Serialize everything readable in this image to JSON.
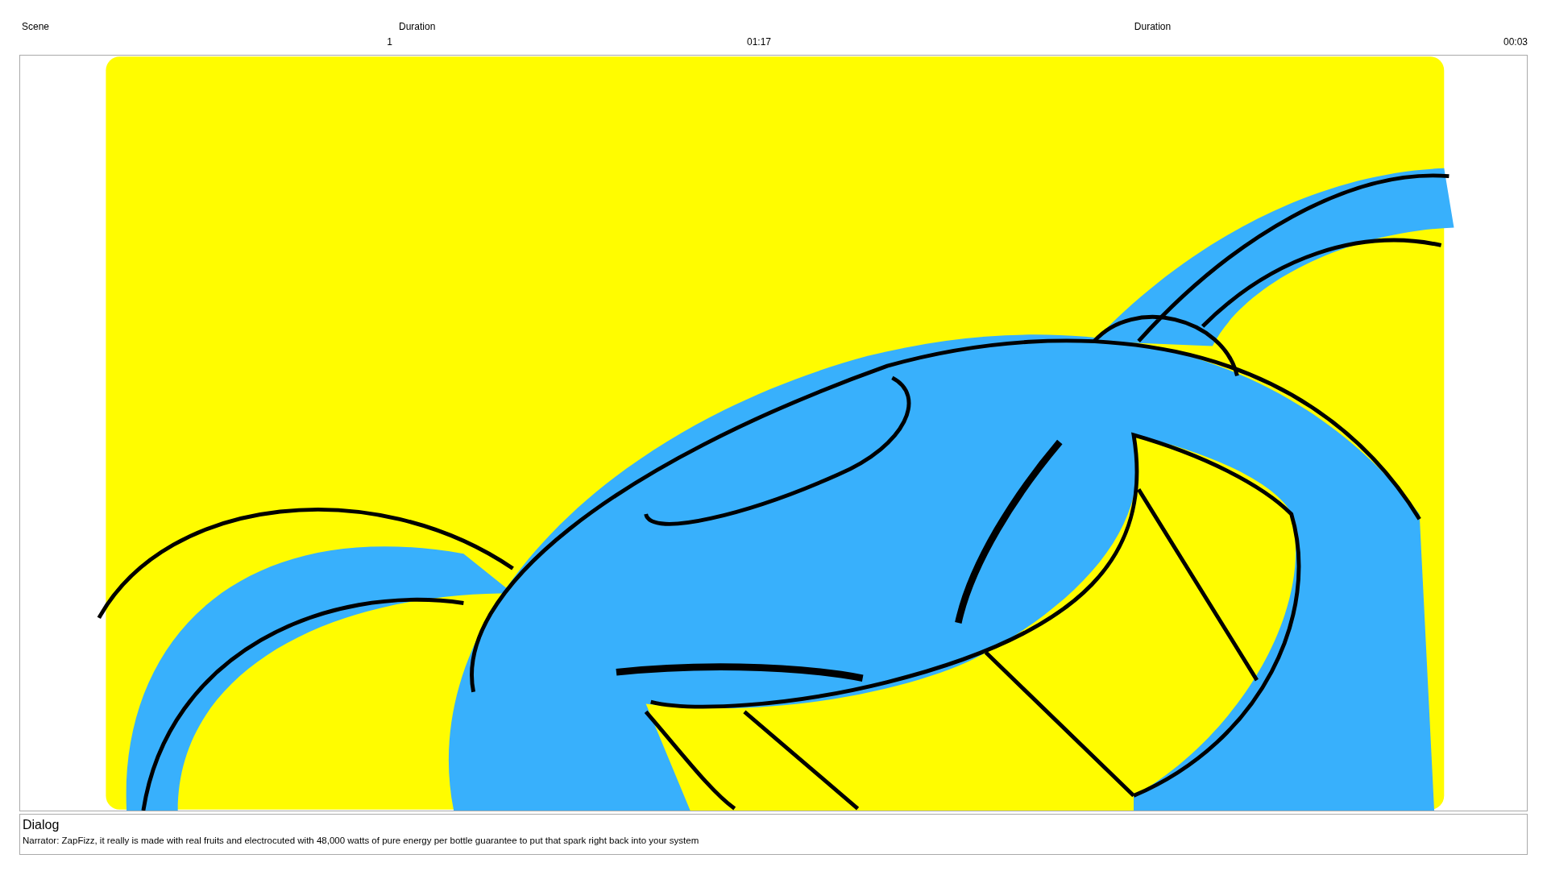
{
  "header": {
    "labels": [
      "Scene",
      "Duration",
      "Duration"
    ],
    "values": [
      "1",
      "01:17",
      "00:03"
    ]
  },
  "dialog": {
    "title": "Dialog",
    "text": "Narrator: ZapFizz, it really is made with real fruits and electrocuted with 48,000 watts of pure energy per bottle guarantee to put that spark right back into your system"
  }
}
